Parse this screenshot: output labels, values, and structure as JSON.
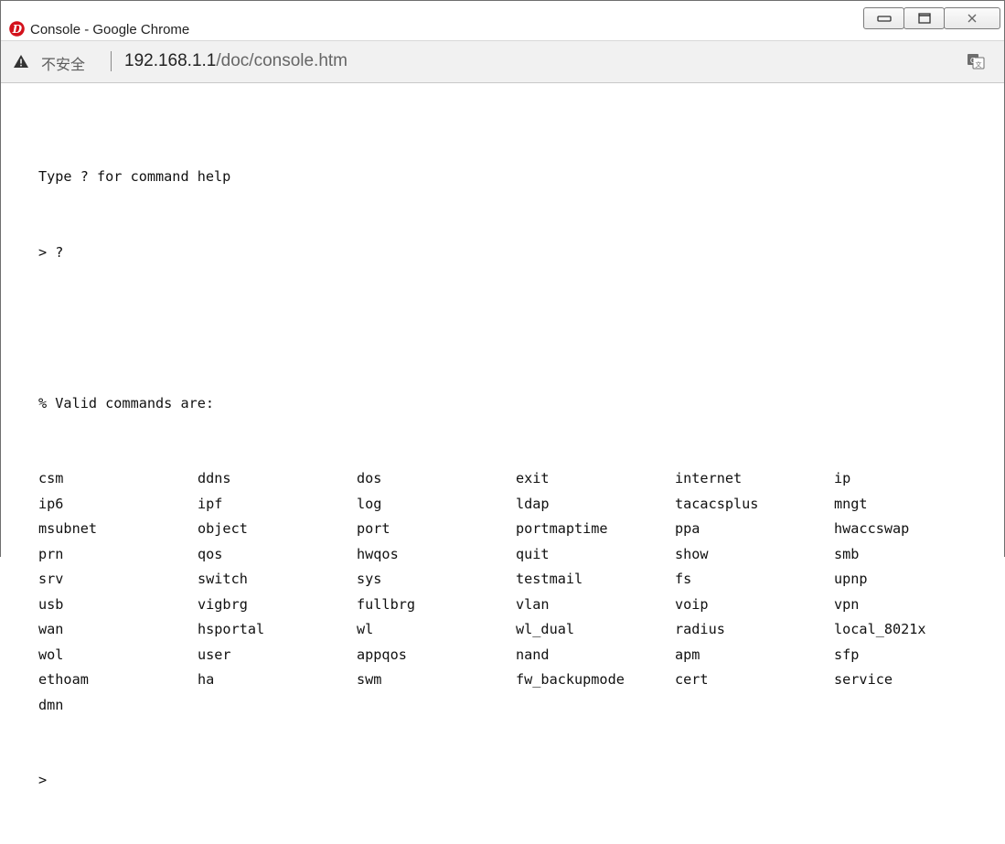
{
  "window": {
    "title": "Console - Google Chrome",
    "accent_logo_color": "#d3111c"
  },
  "address": {
    "security_label": "不安全",
    "url_host": "192.168.1.1",
    "url_path": "/doc/console.htm"
  },
  "console": {
    "intro": "Type ? for command help",
    "prompt_input": "> ?",
    "header": "% Valid commands are:",
    "rows": [
      [
        "csm",
        "ddns",
        "dos",
        "exit",
        "internet",
        "ip"
      ],
      [
        "ip6",
        "ipf",
        "log",
        "ldap",
        "tacacsplus",
        "mngt"
      ],
      [
        "msubnet",
        "object",
        "port",
        "portmaptime",
        "ppa",
        "hwaccswap"
      ],
      [
        "prn",
        "qos",
        "hwqos",
        "quit",
        "show",
        "smb"
      ],
      [
        "srv",
        "switch",
        "sys",
        "testmail",
        "fs",
        "upnp"
      ],
      [
        "usb",
        "vigbrg",
        "fullbrg",
        "vlan",
        "voip",
        "vpn"
      ],
      [
        "wan",
        "hsportal",
        "wl",
        "wl_dual",
        "radius",
        "local_8021x"
      ],
      [
        "wol",
        "user",
        "appqos",
        "nand",
        "apm",
        "sfp"
      ],
      [
        "ethoam",
        "ha",
        "swm",
        "fw_backupmode",
        "cert",
        "service"
      ],
      [
        "dmn"
      ]
    ],
    "final_prompt": ">"
  }
}
